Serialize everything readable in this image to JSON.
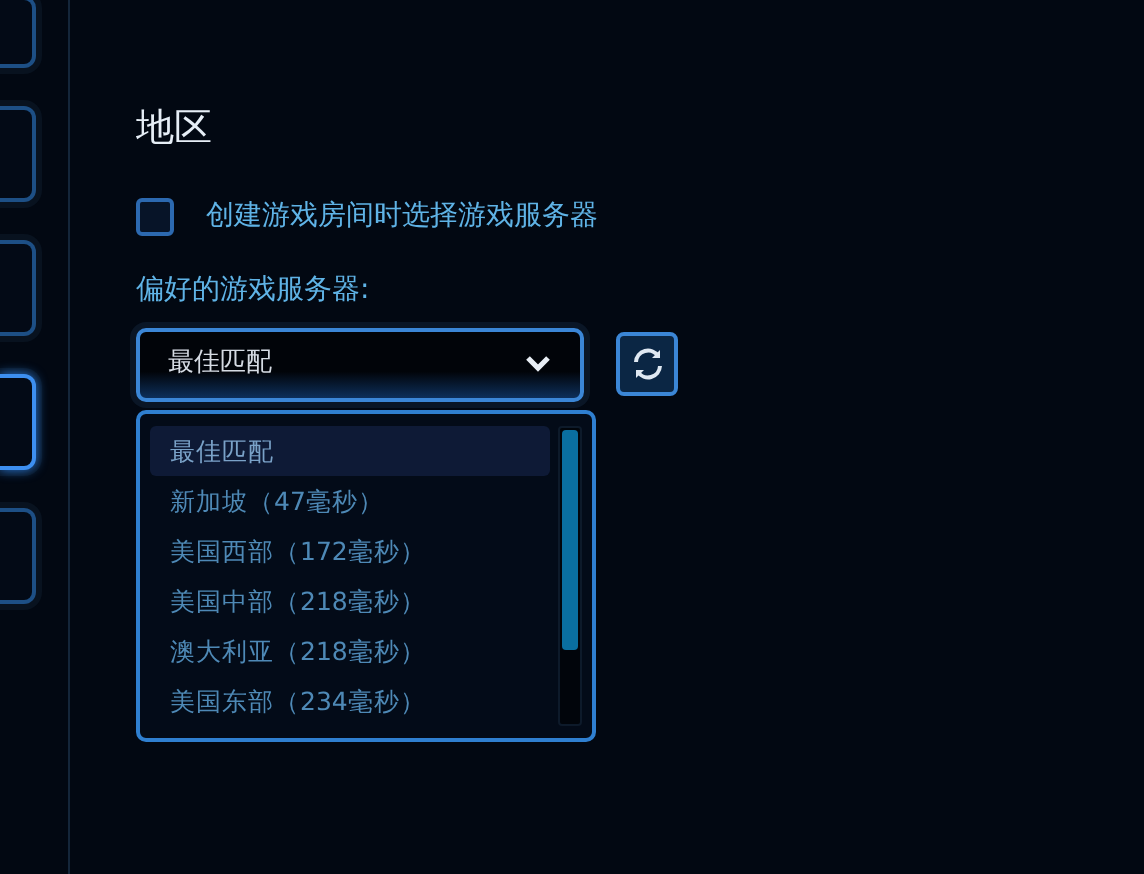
{
  "sidebar_tabs": [
    {
      "selected": false
    },
    {
      "selected": false
    },
    {
      "selected": false
    },
    {
      "selected": true
    },
    {
      "selected": false
    }
  ],
  "section": {
    "title": "地区",
    "checkbox": {
      "label": "创建游戏房间时选择游戏服务器",
      "checked": false
    },
    "server_label": "偏好的游戏服务器:",
    "dropdown": {
      "value": "最佳匹配",
      "expanded": true
    },
    "options": [
      {
        "label": "最佳匹配",
        "selected": true
      },
      {
        "label": "新加坡（47毫秒）",
        "selected": false
      },
      {
        "label": "美国西部（172毫秒）",
        "selected": false
      },
      {
        "label": "美国中部（218毫秒）",
        "selected": false
      },
      {
        "label": "澳大利亚（218毫秒）",
        "selected": false
      },
      {
        "label": "美国东部（234毫秒）",
        "selected": false
      }
    ]
  }
}
